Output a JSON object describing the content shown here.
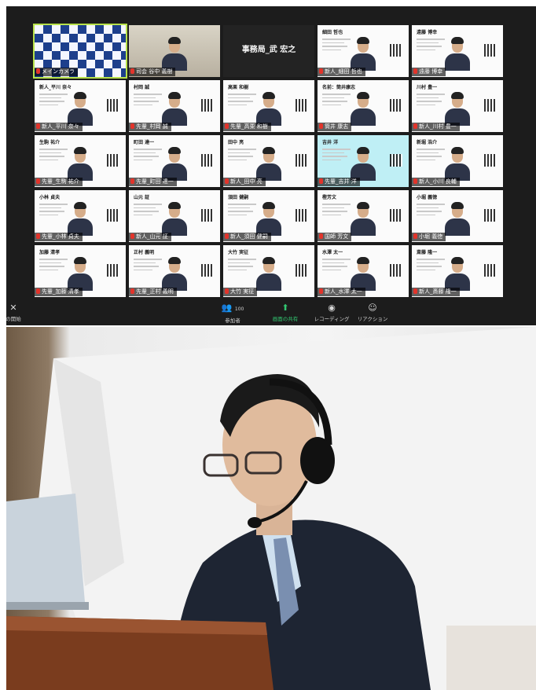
{
  "meeting": {
    "tiles": [
      {
        "row": 0,
        "col": 0,
        "kind": "checker",
        "name": "メインカメラ",
        "speaker": true
      },
      {
        "row": 0,
        "col": 1,
        "kind": "camera",
        "name": "司会 谷中 義樹",
        "person": true
      },
      {
        "row": 0,
        "col": 2,
        "kind": "dark",
        "banner": "事務局_武 宏之",
        "name": ""
      },
      {
        "row": 0,
        "col": 3,
        "kind": "card",
        "title": "細田 哲也",
        "name": "新人_細田 哲也",
        "person": true
      },
      {
        "row": 0,
        "col": 4,
        "kind": "card",
        "title": "遠藤 博幸",
        "name": "遠藤 博幸",
        "person": true
      },
      {
        "row": 1,
        "col": 0,
        "kind": "card",
        "title": "新人_平川 奈々",
        "name": "新人_平川 奈々",
        "person": true
      },
      {
        "row": 1,
        "col": 1,
        "kind": "card",
        "title": "村岡 誠",
        "name": "先輩_村岡 誠",
        "person": true
      },
      {
        "row": 1,
        "col": 2,
        "kind": "card",
        "title": "高栗 和樹",
        "name": "先輩_高栗 和樹",
        "person": true
      },
      {
        "row": 1,
        "col": 3,
        "kind": "card",
        "title": "名前：筒井康志",
        "name": "筒井 康志",
        "person": true
      },
      {
        "row": 1,
        "col": 4,
        "kind": "card",
        "title": "川村 豊一",
        "name": "新人_川村 豊一",
        "person": true
      },
      {
        "row": 2,
        "col": 0,
        "kind": "card",
        "title": "生駒 祐介",
        "name": "先輩_生駒 祐介",
        "person": true
      },
      {
        "row": 2,
        "col": 1,
        "kind": "card",
        "title": "町田 達一",
        "name": "先輩_町田 達一",
        "person": true
      },
      {
        "row": 2,
        "col": 2,
        "kind": "card",
        "title": "田中 亮",
        "name": "新人_田中 亮",
        "person": true
      },
      {
        "row": 2,
        "col": 3,
        "kind": "cyan",
        "title": "吉井 洋",
        "name": "先輩_吉井 洋",
        "person": true
      },
      {
        "row": 2,
        "col": 4,
        "kind": "card",
        "title": "新堀 浩介",
        "name": "新人_小川 良輔",
        "person": true
      },
      {
        "row": 3,
        "col": 0,
        "kind": "card",
        "title": "小林 貞夫",
        "name": "先輩_小林 貞夫",
        "person": true
      },
      {
        "row": 3,
        "col": 1,
        "kind": "card",
        "title": "山元 証",
        "name": "新人_山元 証",
        "person": true
      },
      {
        "row": 3,
        "col": 2,
        "kind": "card",
        "title": "須田 健嗣",
        "name": "新人_須田 健嗣",
        "person": true
      },
      {
        "row": 3,
        "col": 3,
        "kind": "card",
        "title": "樫芳文",
        "name": "国師 芳文",
        "person": true
      },
      {
        "row": 3,
        "col": 4,
        "kind": "card",
        "title": "小堀 義徳",
        "name": "小堀 義徳",
        "person": true
      },
      {
        "row": 4,
        "col": 0,
        "kind": "card",
        "title": "加藤 清孝",
        "name": "先輩_加藤 清孝",
        "person": true
      },
      {
        "row": 4,
        "col": 1,
        "kind": "card",
        "title": "正村 義明",
        "name": "先輩_正村 義明",
        "person": true
      },
      {
        "row": 4,
        "col": 2,
        "kind": "card",
        "title": "大竹 実征",
        "name": "大竹 実征",
        "person": true
      },
      {
        "row": 4,
        "col": 3,
        "kind": "card",
        "title": "水澤 太一",
        "name": "新人_水澤 太一",
        "person": true
      },
      {
        "row": 4,
        "col": 4,
        "kind": "card",
        "title": "斎藤 隆一",
        "name": "新人_斎藤 隆一",
        "person": true
      }
    ]
  },
  "toolbar": {
    "video_label": "の開始",
    "participants_label": "参加者",
    "participants_count": "100",
    "share_label": "画面の共有",
    "record_label": "レコーディング",
    "reactions_label": "リアクション"
  },
  "colors": {
    "zoom_bg": "#1c1c1c",
    "active_green": "#32c671",
    "speaker_outline": "#b7e14a",
    "mic_red": "#e2342b"
  },
  "icons": {
    "video": "video-off-icon",
    "participants": "participants-icon",
    "share": "share-screen-icon",
    "record": "record-icon",
    "reactions": "reactions-icon"
  }
}
